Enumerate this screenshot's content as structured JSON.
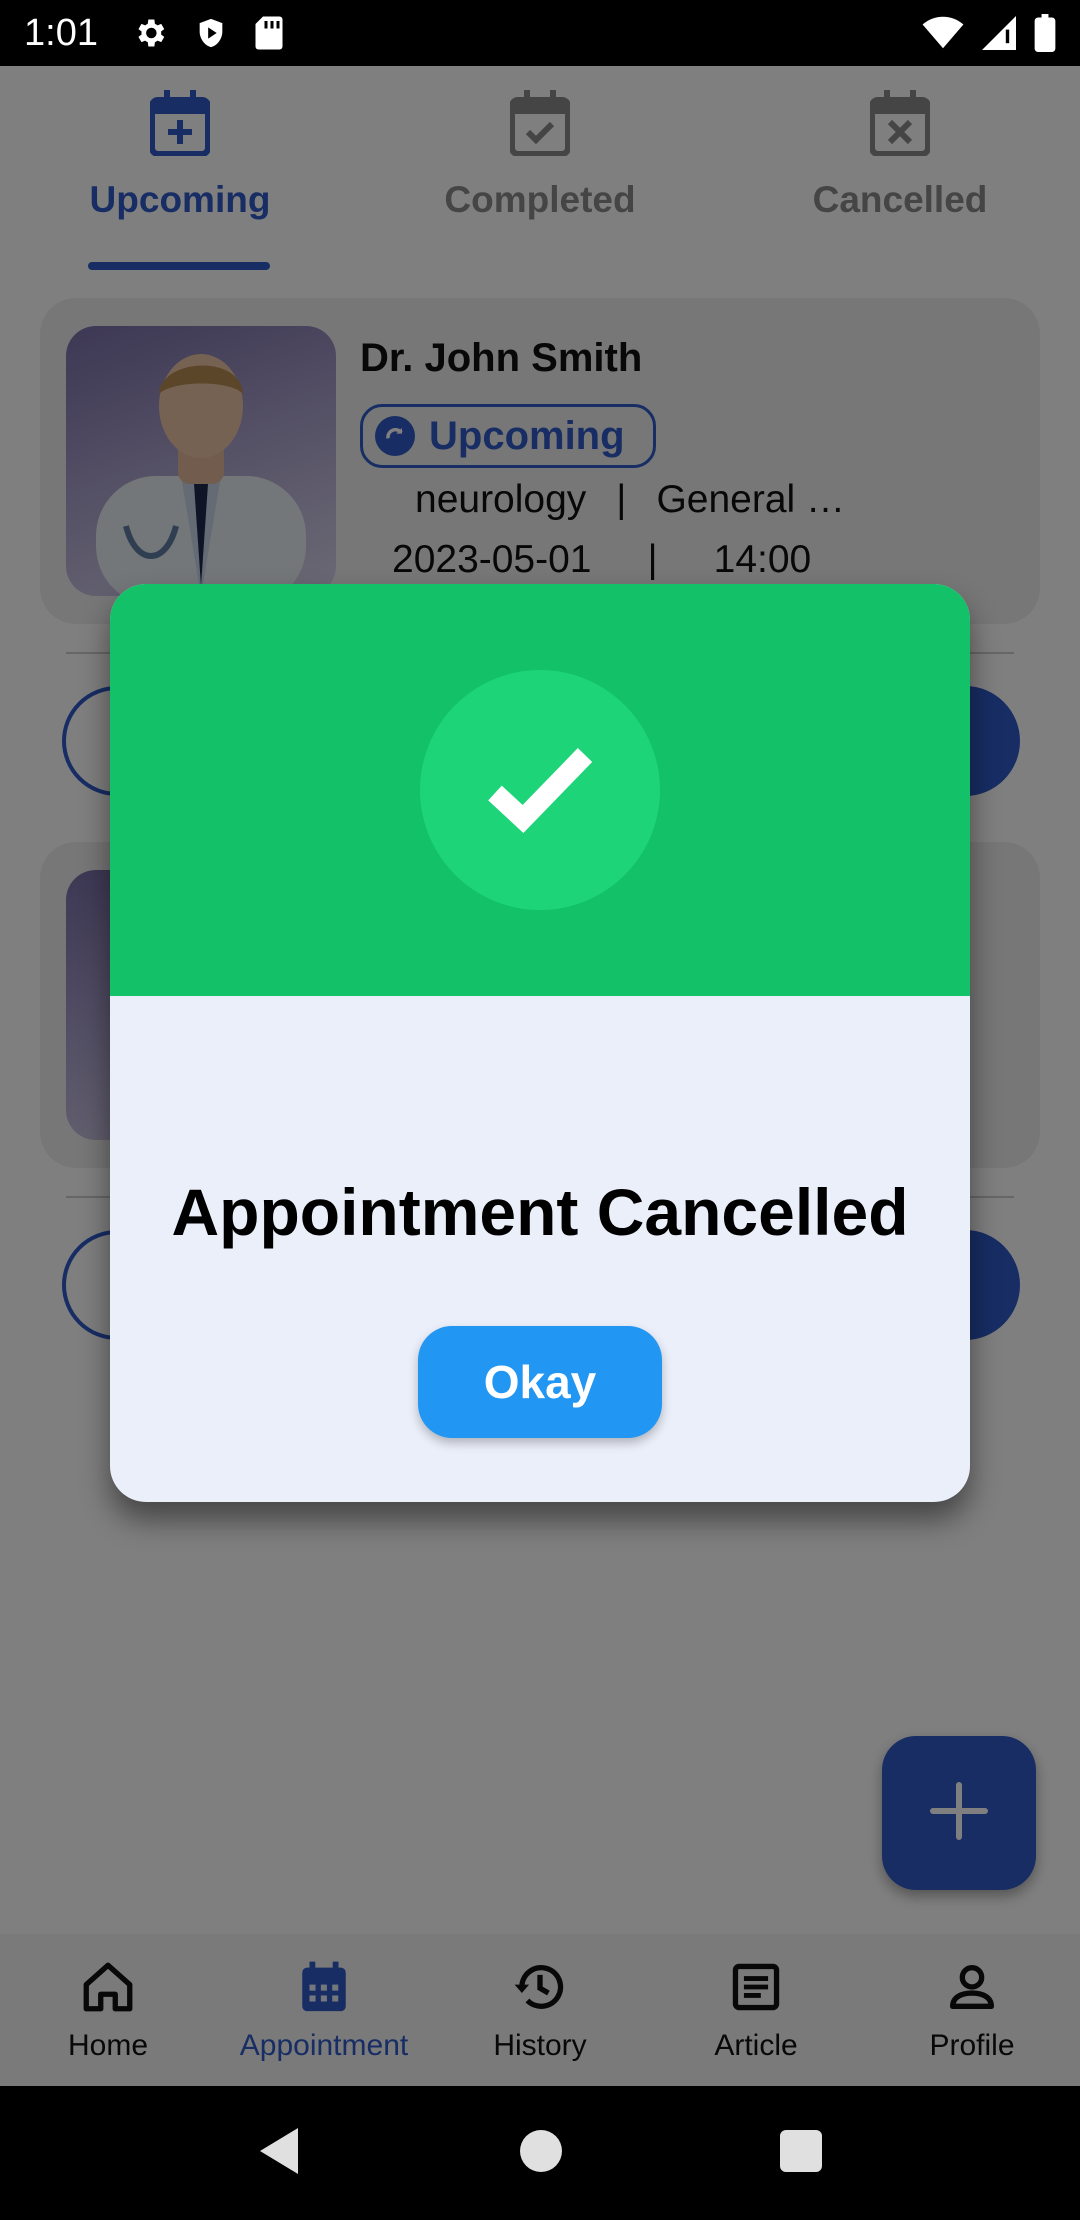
{
  "status_bar": {
    "time": "1:01",
    "icons_left": [
      "gear-icon",
      "shield-icon",
      "sd-card-icon"
    ],
    "icons_right": [
      "wifi-icon",
      "signal-icon",
      "battery-icon"
    ]
  },
  "tabs": [
    {
      "label": "Upcoming",
      "icon": "calendar-plus-icon",
      "active": true
    },
    {
      "label": "Completed",
      "icon": "calendar-check-icon",
      "active": false
    },
    {
      "label": "Cancelled",
      "icon": "calendar-x-icon",
      "active": false
    }
  ],
  "appointments": [
    {
      "doctor": "Dr. John Smith",
      "status": "Upcoming",
      "specialty": "neurology",
      "separator": "|",
      "type": "General …",
      "date": "2023-05-01",
      "time": "14:00"
    }
  ],
  "dialog": {
    "title": "Appointment Cancelled",
    "button": "Okay",
    "header_color": "#12c168",
    "icon": "check-icon"
  },
  "fab": {
    "icon": "plus-icon"
  },
  "bottom_nav": [
    {
      "label": "Home",
      "icon": "home-icon",
      "active": false
    },
    {
      "label": "Appointment",
      "icon": "calendar-icon",
      "active": true
    },
    {
      "label": "History",
      "icon": "history-icon",
      "active": false
    },
    {
      "label": "Article",
      "icon": "article-icon",
      "active": false
    },
    {
      "label": "Profile",
      "icon": "profile-icon",
      "active": false
    }
  ],
  "colors": {
    "accent": "#2f5bc8",
    "success": "#12c168",
    "button": "#2196f3"
  }
}
